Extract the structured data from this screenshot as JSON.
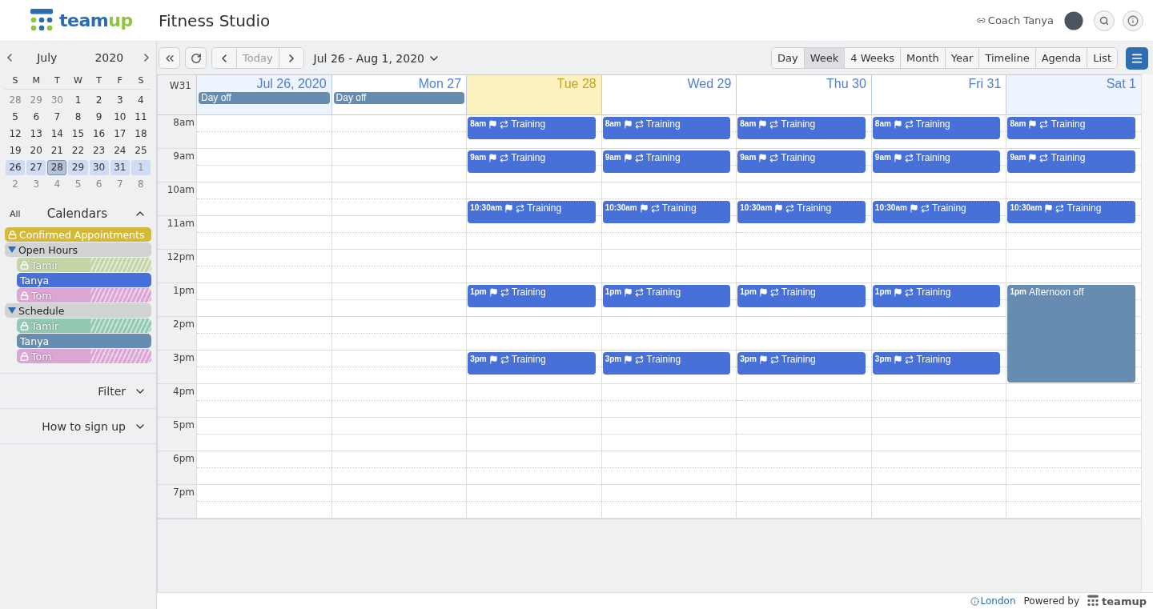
{
  "header": {
    "logo": [
      "team",
      "up"
    ],
    "title": "Fitness Studio",
    "user": "Coach Tanya"
  },
  "mini_calendar": {
    "month": "July",
    "year": "2020",
    "weekdays": [
      "S",
      "M",
      "T",
      "W",
      "T",
      "F",
      "S"
    ],
    "weeks": [
      {
        "in_week": false,
        "days": [
          {
            "label": "28",
            "muted": true,
            "selected": false
          },
          {
            "label": "29",
            "muted": true,
            "selected": false
          },
          {
            "label": "30",
            "muted": true,
            "selected": false
          },
          {
            "label": "1",
            "muted": false,
            "selected": false
          },
          {
            "label": "2",
            "muted": false,
            "selected": false
          },
          {
            "label": "3",
            "muted": false,
            "selected": false
          },
          {
            "label": "4",
            "muted": false,
            "selected": false
          }
        ]
      },
      {
        "in_week": false,
        "days": [
          {
            "label": "5",
            "muted": false,
            "selected": false
          },
          {
            "label": "6",
            "muted": false,
            "selected": false
          },
          {
            "label": "7",
            "muted": false,
            "selected": false
          },
          {
            "label": "8",
            "muted": false,
            "selected": false
          },
          {
            "label": "9",
            "muted": false,
            "selected": false
          },
          {
            "label": "10",
            "muted": false,
            "selected": false
          },
          {
            "label": "11",
            "muted": false,
            "selected": false
          }
        ]
      },
      {
        "in_week": false,
        "days": [
          {
            "label": "12",
            "muted": false,
            "selected": false
          },
          {
            "label": "13",
            "muted": false,
            "selected": false
          },
          {
            "label": "14",
            "muted": false,
            "selected": false
          },
          {
            "label": "15",
            "muted": false,
            "selected": false
          },
          {
            "label": "16",
            "muted": false,
            "selected": false
          },
          {
            "label": "17",
            "muted": false,
            "selected": false
          },
          {
            "label": "18",
            "muted": false,
            "selected": false
          }
        ]
      },
      {
        "in_week": false,
        "days": [
          {
            "label": "19",
            "muted": false,
            "selected": false
          },
          {
            "label": "20",
            "muted": false,
            "selected": false
          },
          {
            "label": "21",
            "muted": false,
            "selected": false
          },
          {
            "label": "22",
            "muted": false,
            "selected": false
          },
          {
            "label": "23",
            "muted": false,
            "selected": false
          },
          {
            "label": "24",
            "muted": false,
            "selected": false
          },
          {
            "label": "25",
            "muted": false,
            "selected": false
          }
        ]
      },
      {
        "in_week": true,
        "days": [
          {
            "label": "26",
            "muted": false,
            "selected": false
          },
          {
            "label": "27",
            "muted": false,
            "selected": false
          },
          {
            "label": "28",
            "muted": false,
            "selected": true
          },
          {
            "label": "29",
            "muted": false,
            "selected": false
          },
          {
            "label": "30",
            "muted": false,
            "selected": false
          },
          {
            "label": "31",
            "muted": false,
            "selected": false
          },
          {
            "label": "1",
            "muted": true,
            "selected": false
          }
        ]
      },
      {
        "in_week": false,
        "days": [
          {
            "label": "2",
            "muted": true,
            "selected": false
          },
          {
            "label": "3",
            "muted": true,
            "selected": false
          },
          {
            "label": "4",
            "muted": true,
            "selected": false
          },
          {
            "label": "5",
            "muted": true,
            "selected": false
          },
          {
            "label": "6",
            "muted": true,
            "selected": false
          },
          {
            "label": "7",
            "muted": true,
            "selected": false
          },
          {
            "label": "8",
            "muted": true,
            "selected": false
          }
        ]
      }
    ]
  },
  "calendars": {
    "all_label": "All",
    "title": "Calendars",
    "expanded": true,
    "items": [
      {
        "kind": "calendar",
        "name": "Confirmed Appointments",
        "color": "#d4b83a",
        "locked": true,
        "active": true
      },
      {
        "kind": "folder",
        "name": "Open Hours",
        "expanded": true,
        "children": [
          {
            "kind": "calendar",
            "name": "Tamir",
            "color": "#c3d6a8",
            "locked": true,
            "active": false
          },
          {
            "kind": "calendar",
            "name": "Tanya",
            "color": "#4770d8",
            "locked": false,
            "active": true
          },
          {
            "kind": "calendar",
            "name": "Tom",
            "color": "#dba6d4",
            "locked": true,
            "active": false
          }
        ]
      },
      {
        "kind": "folder",
        "name": "Schedule",
        "expanded": true,
        "children": [
          {
            "kind": "calendar",
            "name": "Tamir",
            "color": "#93c8b3",
            "locked": true,
            "active": false
          },
          {
            "kind": "calendar",
            "name": "Tanya",
            "color": "#668cb1",
            "locked": false,
            "active": true
          },
          {
            "kind": "calendar",
            "name": "Tom",
            "color": "#dba6d4",
            "locked": true,
            "active": false
          }
        ]
      }
    ]
  },
  "sections": [
    {
      "title": "Filter",
      "expanded": false
    },
    {
      "title": "How to sign up",
      "expanded": false
    }
  ],
  "toolbar": {
    "today": "Today",
    "range": "Jul 26 - Aug 1, 2020",
    "views": [
      {
        "label": "Day",
        "selected": false
      },
      {
        "label": "Week",
        "selected": true
      },
      {
        "label": "4 Weeks",
        "selected": false
      },
      {
        "label": "Month",
        "selected": false
      },
      {
        "label": "Year",
        "selected": false
      },
      {
        "label": "Timeline",
        "selected": false
      },
      {
        "label": "Agenda",
        "selected": false
      },
      {
        "label": "List",
        "selected": false
      }
    ]
  },
  "week": {
    "label": "W31",
    "hours": [
      "8am",
      "9am",
      "10am",
      "11am",
      "12pm",
      "1pm",
      "2pm",
      "3pm",
      "4pm",
      "5pm",
      "6pm",
      "7pm"
    ],
    "days": [
      {
        "label": "Jul 26, 2020",
        "today": false,
        "weekend": true,
        "all_day": [
          {
            "title": "Day off",
            "color": "#668cb1"
          }
        ]
      },
      {
        "label": "Mon 27",
        "today": false,
        "weekend": false,
        "all_day": [
          {
            "title": "Day off",
            "color": "#668cb1"
          }
        ]
      },
      {
        "label": "Tue 28",
        "today": true,
        "weekend": false,
        "events": [
          {
            "kind": "short",
            "time": "8am",
            "title": "Training",
            "flagged": true,
            "recurring": true,
            "color": "#4770d8"
          },
          {
            "kind": "short",
            "time": "9am",
            "title": "Training",
            "flagged": true,
            "recurring": true,
            "color": "#4770d8"
          },
          {
            "kind": "short",
            "time": "10:30am",
            "title": "Training",
            "flagged": true,
            "recurring": true,
            "color": "#4770d8"
          },
          {
            "kind": "short",
            "time": "1pm",
            "title": "Training",
            "flagged": true,
            "recurring": true,
            "color": "#4770d8"
          },
          {
            "kind": "short",
            "time": "3pm",
            "title": "Training",
            "flagged": true,
            "recurring": true,
            "color": "#4770d8"
          }
        ]
      },
      {
        "label": "Wed 29",
        "today": false,
        "weekend": false,
        "events": [
          {
            "kind": "short",
            "time": "8am",
            "title": "Training",
            "flagged": true,
            "recurring": true,
            "color": "#4770d8"
          },
          {
            "kind": "short",
            "time": "9am",
            "title": "Training",
            "flagged": true,
            "recurring": true,
            "color": "#4770d8"
          },
          {
            "kind": "short",
            "time": "10:30am",
            "title": "Training",
            "flagged": true,
            "recurring": true,
            "color": "#4770d8"
          },
          {
            "kind": "short",
            "time": "1pm",
            "title": "Training",
            "flagged": true,
            "recurring": true,
            "color": "#4770d8"
          },
          {
            "kind": "short",
            "time": "3pm",
            "title": "Training",
            "flagged": true,
            "recurring": true,
            "color": "#4770d8"
          }
        ]
      },
      {
        "label": "Thu 30",
        "today": false,
        "weekend": false,
        "events": [
          {
            "kind": "short",
            "time": "8am",
            "title": "Training",
            "flagged": true,
            "recurring": true,
            "color": "#4770d8"
          },
          {
            "kind": "short",
            "time": "9am",
            "title": "Training",
            "flagged": true,
            "recurring": true,
            "color": "#4770d8"
          },
          {
            "kind": "short",
            "time": "10:30am",
            "title": "Training",
            "flagged": true,
            "recurring": true,
            "color": "#4770d8"
          },
          {
            "kind": "short",
            "time": "1pm",
            "title": "Training",
            "flagged": true,
            "recurring": true,
            "color": "#4770d8"
          },
          {
            "kind": "short",
            "time": "3pm",
            "title": "Training",
            "flagged": true,
            "recurring": true,
            "color": "#4770d8"
          }
        ]
      },
      {
        "label": "Fri 31",
        "today": false,
        "weekend": false,
        "events": [
          {
            "kind": "short",
            "time": "8am",
            "title": "Training",
            "flagged": true,
            "recurring": true,
            "color": "#4770d8"
          },
          {
            "kind": "short",
            "time": "9am",
            "title": "Training",
            "flagged": true,
            "recurring": true,
            "color": "#4770d8"
          },
          {
            "kind": "short",
            "time": "10:30am",
            "title": "Training",
            "flagged": true,
            "recurring": true,
            "color": "#4770d8"
          },
          {
            "kind": "short",
            "time": "1pm",
            "title": "Training",
            "flagged": true,
            "recurring": true,
            "color": "#4770d8"
          },
          {
            "kind": "short",
            "time": "3pm",
            "title": "Training",
            "flagged": true,
            "recurring": true,
            "color": "#4770d8"
          }
        ]
      },
      {
        "label": "Sat 1",
        "today": false,
        "weekend": true,
        "events": [
          {
            "kind": "short",
            "time": "8am",
            "title": "Training",
            "flagged": true,
            "recurring": true,
            "color": "#4770d8"
          },
          {
            "kind": "short",
            "time": "9am",
            "title": "Training",
            "flagged": true,
            "recurring": true,
            "color": "#4770d8"
          },
          {
            "kind": "short",
            "time": "10:30am",
            "title": "Training",
            "flagged": true,
            "recurring": true,
            "color": "#4770d8"
          },
          {
            "kind": "block",
            "time": "1pm",
            "title": "Afternoon off",
            "flagged": false,
            "recurring": false,
            "color": "#668cb1"
          }
        ]
      }
    ]
  },
  "footer": {
    "timezone": "London",
    "powered_by": "Powered by",
    "logo": "teamup"
  }
}
